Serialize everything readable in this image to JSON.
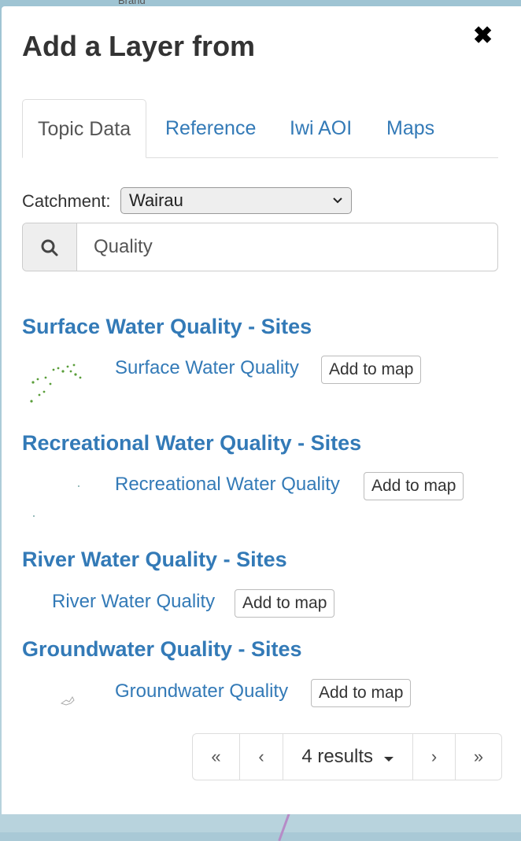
{
  "map": {
    "top_label": "Brand"
  },
  "panel": {
    "title": "Add a Layer from",
    "close_label": "✖"
  },
  "tabs": [
    {
      "label": "Topic Data",
      "active": true
    },
    {
      "label": "Reference",
      "active": false
    },
    {
      "label": "Iwi AOI",
      "active": false
    },
    {
      "label": "Maps",
      "active": false
    }
  ],
  "catchment": {
    "label": "Catchment:",
    "selected": "Wairau"
  },
  "search": {
    "value": "Quality",
    "icon": "search-icon"
  },
  "results": [
    {
      "title": "Surface Water Quality - Sites",
      "layer": "Surface Water Quality",
      "button": "Add to map"
    },
    {
      "title": "Recreational Water Quality - Sites",
      "layer": "Recreational Water Quality",
      "button": "Add to map"
    },
    {
      "title": "River Water Quality - Sites",
      "layer": "River Water Quality",
      "button": "Add to map"
    },
    {
      "title": "Groundwater Quality - Sites",
      "layer": "Groundwater Quality",
      "button": "Add to map"
    }
  ],
  "pager": {
    "first": "«",
    "prev": "‹",
    "count": "4 results",
    "next": "›",
    "last": "»"
  },
  "colors": {
    "link": "#337ab7",
    "text": "#333333"
  }
}
